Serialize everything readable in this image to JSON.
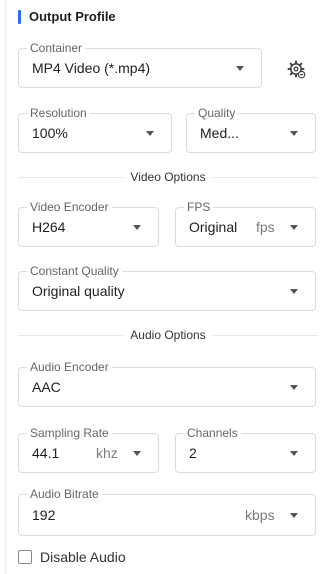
{
  "panel": {
    "title": "Output Profile"
  },
  "container": {
    "label": "Container",
    "value": "MP4 Video (*.mp4)"
  },
  "settings_icon": "gear-icon",
  "resolution": {
    "label": "Resolution",
    "value": "100%"
  },
  "quality": {
    "label": "Quality",
    "value": "Med..."
  },
  "video_section": "Video Options",
  "video_encoder": {
    "label": "Video Encoder",
    "value": "H264"
  },
  "fps": {
    "label": "FPS",
    "value": "Original",
    "unit": "fps"
  },
  "constant_quality": {
    "label": "Constant Quality",
    "value": "Original quality"
  },
  "audio_section": "Audio Options",
  "audio_encoder": {
    "label": "Audio Encoder",
    "value": "AAC"
  },
  "sampling_rate": {
    "label": "Sampling Rate",
    "value": "44.1",
    "unit": "khz"
  },
  "channels": {
    "label": "Channels",
    "value": "2"
  },
  "audio_bitrate": {
    "label": "Audio Bitrate",
    "value": "192",
    "unit": "kbps"
  },
  "disable_audio": {
    "label": "Disable Audio",
    "checked": false
  },
  "colors": {
    "accent": "#2f6df6",
    "border": "#dcdcdc",
    "label": "#666666"
  }
}
